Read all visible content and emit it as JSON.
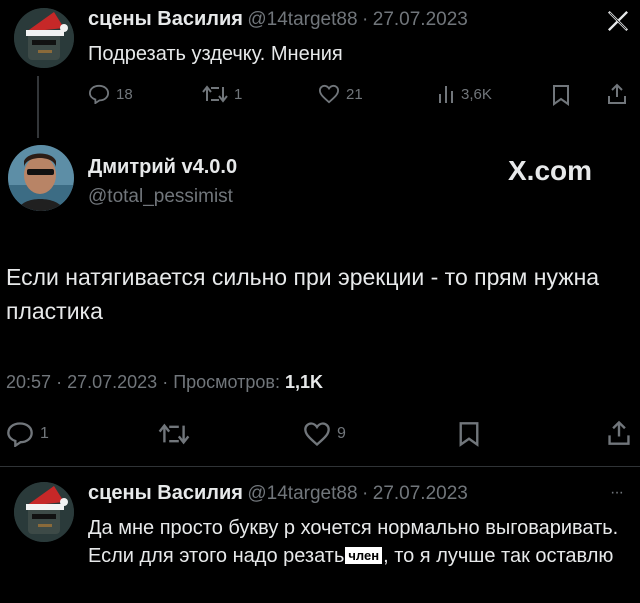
{
  "tweet1": {
    "name": "сцены Василия",
    "handle": "@14target88",
    "sep": "·",
    "date": "27.07.2023",
    "text": "Подрезать уздечку. Мнения",
    "stats": {
      "replies": "18",
      "retweets": "1",
      "likes": "21",
      "views": "3,6K"
    },
    "brand_icon": "x-logo-icon"
  },
  "tweet2": {
    "name": "Дмитрий v4.0.0",
    "handle": "@total_pessimist",
    "brand": "X.com",
    "text": "Если натягивается сильно при эрекции - то прям нужна пластика",
    "meta": {
      "time": "20:57",
      "sep1": "·",
      "date": "27.07.2023",
      "sep2": "·",
      "views_label": "Просмотров:",
      "views": "1,1K"
    },
    "stats": {
      "replies": "1",
      "likes": "9"
    }
  },
  "tweet3": {
    "name": "сцены Василия",
    "handle": "@14target88",
    "sep": "·",
    "date": "27.07.2023",
    "more": "···",
    "text_part1": "Да мне просто букву р хочется нормально выговаривать. Если для этого надо резать",
    "censor": "член",
    "text_part2": ", то я лучше так оставлю"
  },
  "colors": {
    "background": "#000000",
    "text": "#e7e9ea",
    "secondary": "#71767b",
    "divider": "#2f3336"
  }
}
